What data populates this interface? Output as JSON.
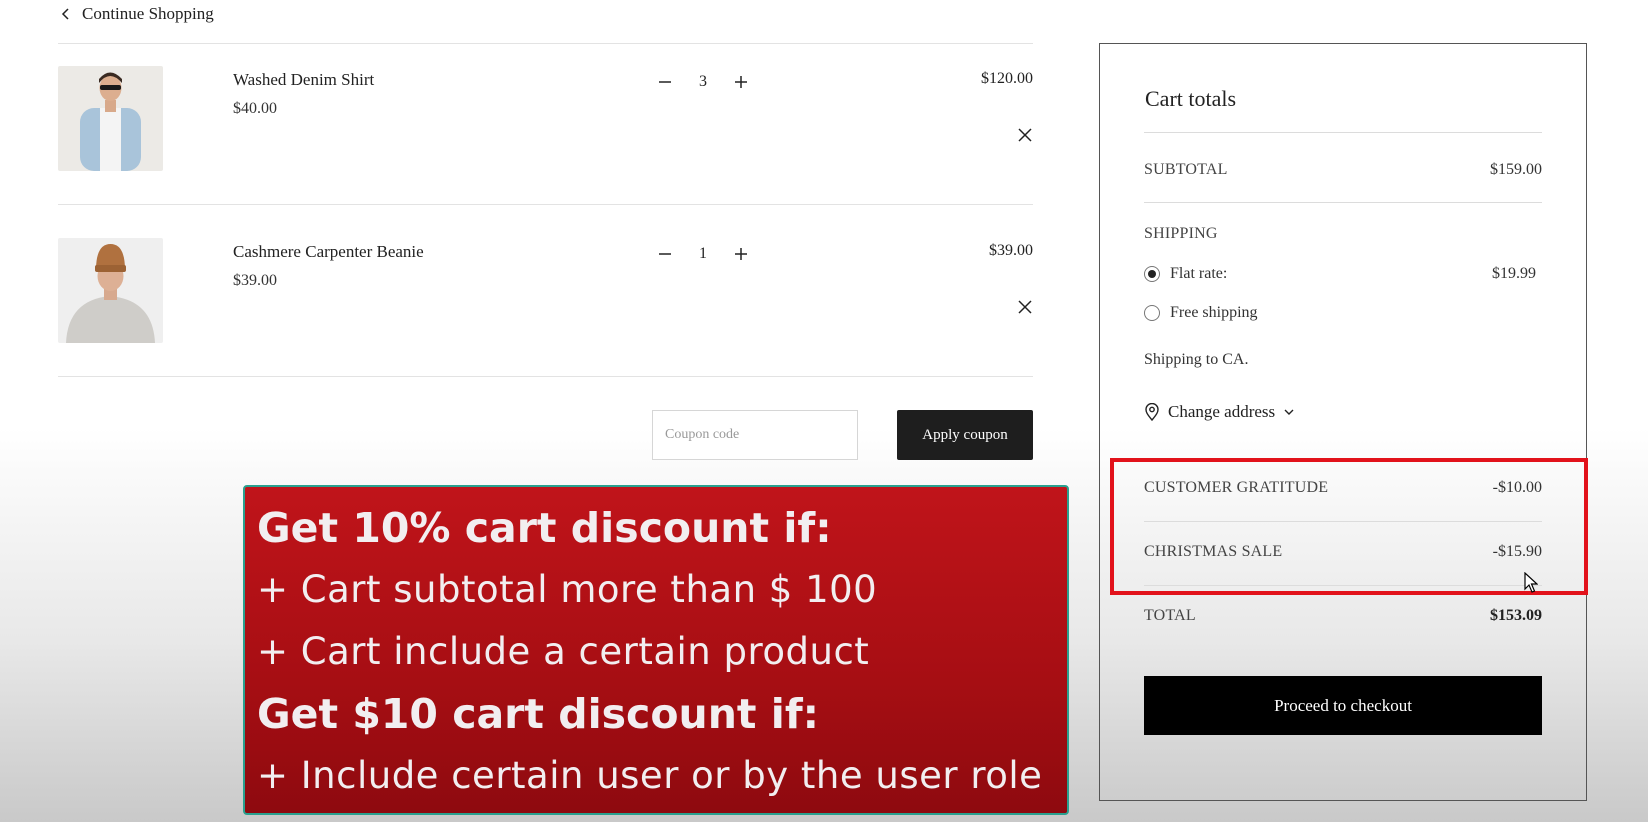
{
  "nav": {
    "continue_label": "Continue Shopping"
  },
  "cart": {
    "items": [
      {
        "name": "Washed Denim Shirt",
        "unit_price": "$40.00",
        "quantity": "3",
        "line_total": "$120.00"
      },
      {
        "name": "Cashmere Carpenter Beanie",
        "unit_price": "$39.00",
        "quantity": "1",
        "line_total": "$39.00"
      }
    ]
  },
  "coupon": {
    "placeholder": "Coupon code",
    "button_label": "Apply coupon"
  },
  "promo": {
    "heading_1": "Get 10% cart discount if:",
    "condition_1": "+ Cart subtotal more than $ 100",
    "condition_2": "+ Cart include a certain product",
    "heading_2": "Get $10 cart discount if:",
    "condition_3": "+ Include certain user or by the user role"
  },
  "totals": {
    "title": "Cart totals",
    "subtotal_label": "SUBTOTAL",
    "subtotal_value": "$159.00",
    "shipping_label": "SHIPPING",
    "shipping_options": [
      {
        "label": "Flat rate:",
        "price": "$19.99",
        "selected": true
      },
      {
        "label": "Free shipping",
        "price": "",
        "selected": false
      }
    ],
    "shipping_to": "Shipping to CA.",
    "change_address_label": "Change address",
    "discounts": [
      {
        "label": "CUSTOMER GRATITUDE",
        "value": "-$10.00"
      },
      {
        "label": "CHRISTMAS SALE",
        "value": "-$15.90"
      }
    ],
    "total_label": "TOTAL",
    "total_value": "$153.09",
    "checkout_label": "Proceed to checkout"
  },
  "colors": {
    "highlight": "#e2121b",
    "promo_bg": "#b01017",
    "button_dark": "#1e1e1e"
  }
}
